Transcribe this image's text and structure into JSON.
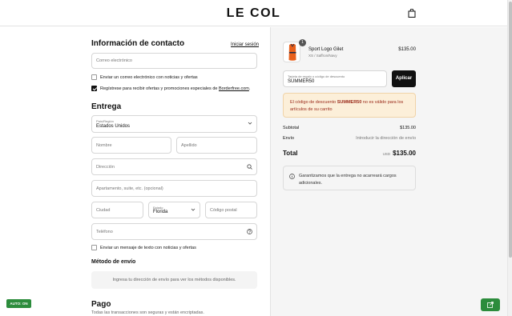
{
  "header": {
    "logo": "LE COL",
    "bag_icon": "shopping-bag-icon"
  },
  "contact": {
    "title": "Información de contacto",
    "login_link": "Iniciar sesión",
    "email_placeholder": "Correo electrónico",
    "email_news_label": "Enviar un correo electrónico con noticias y ofertas",
    "email_news_checked": false,
    "register_prefix": "Regístrese para recibir ofertas y promociones especiales de ",
    "register_link": "Borderfree.com",
    "register_suffix": ".",
    "register_checked": true
  },
  "delivery": {
    "title": "Entrega",
    "country_label": "País/Región",
    "country_value": "Estados Unidos",
    "first_name_placeholder": "Nombre",
    "last_name_placeholder": "Apellido",
    "address_placeholder": "Dirección",
    "apartment_placeholder": "Apartamento, suite, etc. (opcional)",
    "city_placeholder": "Ciudad",
    "state_label": "Estado",
    "state_value": "Florida",
    "zip_placeholder": "Código postal",
    "phone_placeholder": "Teléfono",
    "sms_label": "Enviar un mensaje de texto con noticias y ofertas",
    "sms_checked": false
  },
  "shipping_method": {
    "title": "Método de envío",
    "placeholder_text": "Ingresa tu dirección de envío para ver los métodos disponibles."
  },
  "payment": {
    "title": "Pago",
    "subtitle": "Todas las transacciones son seguras y están encriptadas."
  },
  "auto_button": "AUTO: ON",
  "summary": {
    "product": {
      "quantity_badge": "1",
      "name": "Sport Logo Gilet",
      "variant": "XS / Saffron/Navy",
      "price": "$135.00"
    },
    "discount": {
      "label": "Tarjeta de regalo o código de descuento",
      "value": "SUMMER50",
      "apply_label": "Aplicar"
    },
    "alert": {
      "prefix": "El código de descuento ",
      "code": "SUMMER50",
      "suffix": " no es válido para los artículos de su carrito"
    },
    "subtotal_label": "Subtotal",
    "subtotal_value": "$135.00",
    "shipping_label": "Envío",
    "shipping_value": "Introducir la dirección de envío",
    "total_label": "Total",
    "total_currency": "USD",
    "total_value": "$135.00",
    "info_text": "Garantizamos que la entrega no acarreará cargos adicionales."
  },
  "colors": {
    "accent_green": "#2c8c3c",
    "alert_bg": "#fcefd9",
    "alert_text": "#9a2a1a",
    "product_orange": "#e8601c"
  }
}
